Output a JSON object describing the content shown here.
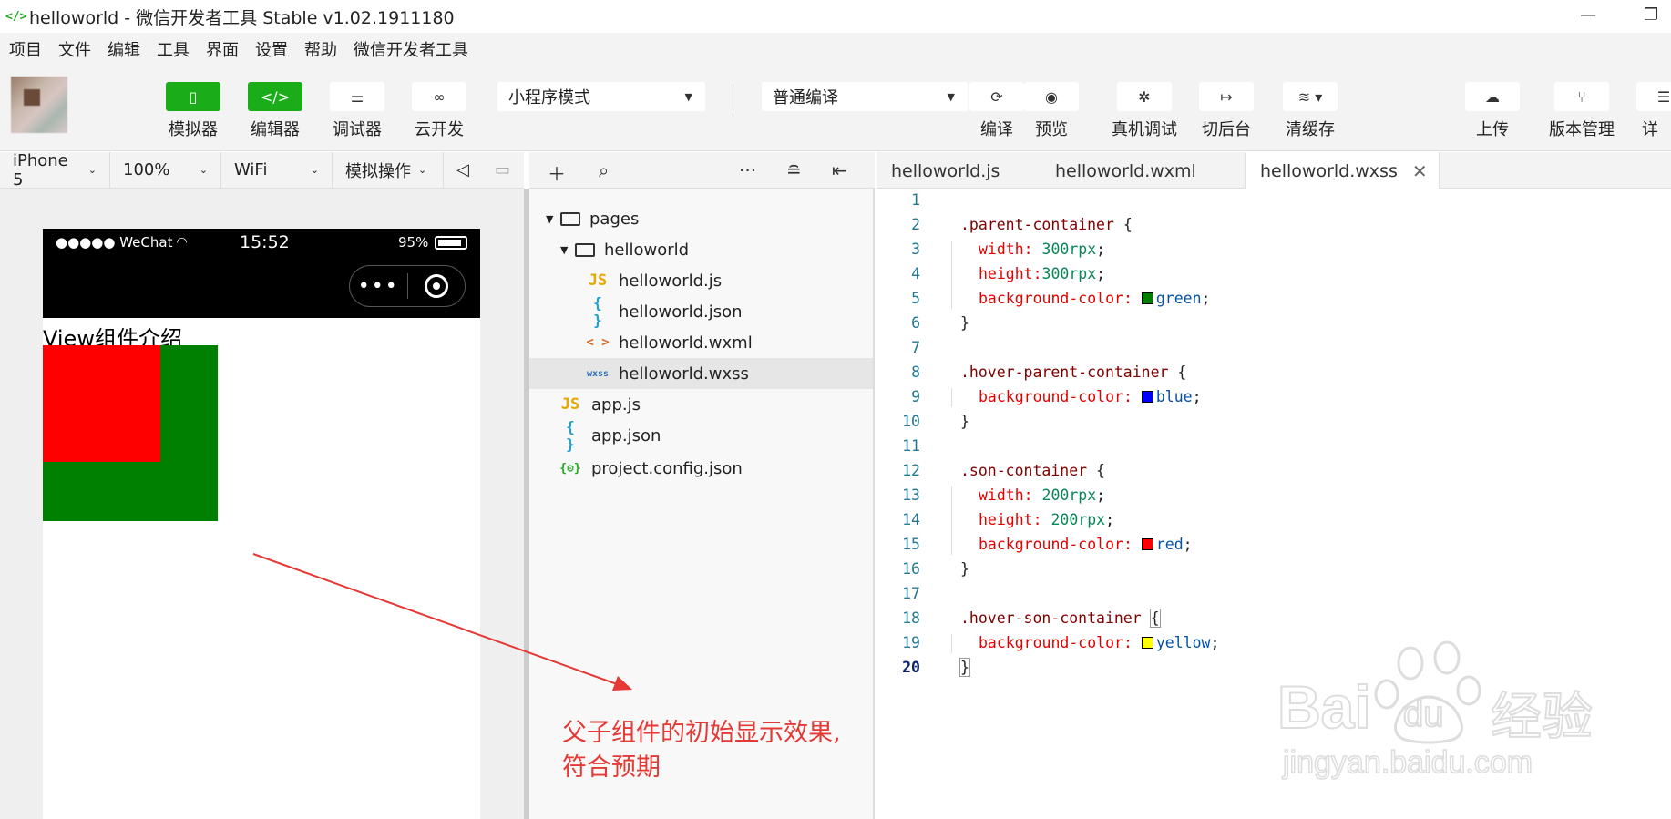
{
  "window": {
    "title": "helloworld - 微信开发者工具 Stable v1.02.1911180",
    "minimize": "—",
    "restore": "❐"
  },
  "menu": [
    "项目",
    "文件",
    "编辑",
    "工具",
    "界面",
    "设置",
    "帮助",
    "微信开发者工具"
  ],
  "toolbar": {
    "simulator": "模拟器",
    "editor": "编辑器",
    "debugger": "调试器",
    "cloud": "云开发",
    "mode": "小程序模式",
    "compile_mode": "普通编译",
    "compile": "编译",
    "preview": "预览",
    "remote_debug": "真机调试",
    "background": "切后台",
    "clear_cache": "清缓存",
    "upload": "上传",
    "version": "版本管理",
    "detail": "详"
  },
  "simbar": {
    "device": "iPhone 5",
    "zoom": "100%",
    "network": "WiFi",
    "operate": "模拟操作"
  },
  "phone": {
    "carrier": "●●●●● WeChat",
    "time": "15:52",
    "battery": "95%",
    "page_title": "View组件介绍"
  },
  "tree": {
    "pages": "pages",
    "helloworld": "helloworld",
    "files": [
      "helloworld.js",
      "helloworld.json",
      "helloworld.wxml",
      "helloworld.wxss"
    ],
    "app_js": "app.js",
    "app_json": "app.json",
    "project_config": "project.config.json"
  },
  "tabs": [
    "helloworld.js",
    "helloworld.wxml",
    "helloworld.wxss"
  ],
  "code": {
    "l2_sel": ".parent-container",
    "brace_open": " {",
    "brace_close": "}",
    "width": "width:",
    "height": "height:",
    "height2": "height:",
    "bg": "background-color:",
    "v300a": " 300rpx",
    "v300b": "300rpx",
    "green": "green",
    "l8_sel": ".hover-parent-container",
    "blue": "blue",
    "l12_sel": ".son-container",
    "v200a": " 200rpx",
    "v200b": " 200rpx",
    "red": "red",
    "l18_sel": ".hover-son-container",
    "yellow": "yellow",
    "semi": ";"
  },
  "annotation": {
    "line1": "父子组件的初始显示效果,",
    "line2": "符合预期"
  },
  "watermark": {
    "brand": "Bai",
    "du": "du",
    "jingyan": "经验",
    "url": "jingyan.baidu.com"
  },
  "colors": {
    "accent": "#1aad19",
    "parent": "#008000",
    "son": "#ff0000",
    "annotation": "#e53935"
  }
}
